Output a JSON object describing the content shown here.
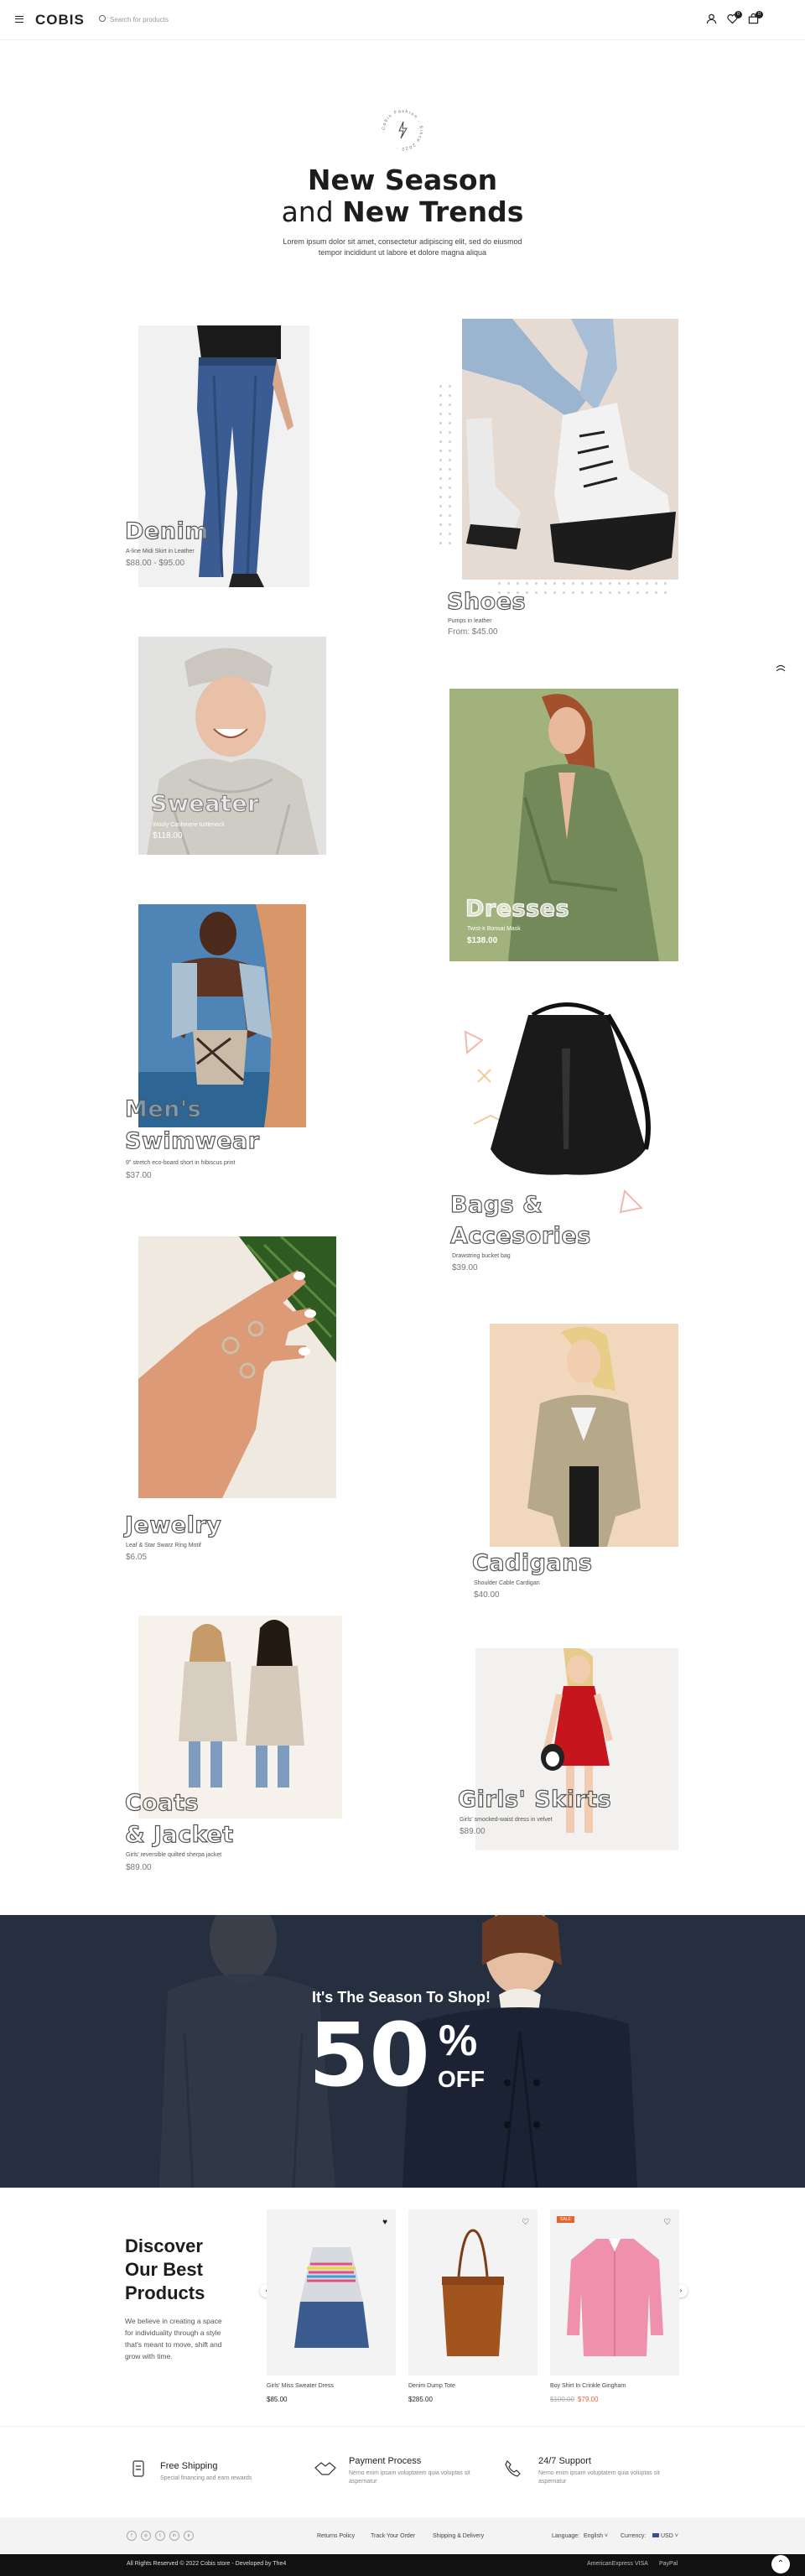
{
  "header": {
    "logo": "COBIS",
    "search_placeholder": "Search for products",
    "wishlist_count": "0",
    "cart_count": "0"
  },
  "hero": {
    "stamp_text": "Cobis Fashion · Since 2022 ·",
    "title_line1": "New Season",
    "title_line2_plain": "and ",
    "title_line2_bold": "New Trends",
    "subtitle": "Lorem ipsum dolor sit amet, consectetur adipiscing elit, sed do eiusmod tempor incididunt ut labore et dolore magna aliqua"
  },
  "categories": [
    {
      "name": "Denim",
      "desc": "A-line Midi Skirt in Leather",
      "price": "$88.00 - $95.00"
    },
    {
      "name": "Shoes",
      "desc": "Pumps in leather",
      "price": "From: $45.00"
    },
    {
      "name": "Sweater",
      "desc": "Wooly Cashmere turtleneck",
      "price": "$118.00"
    },
    {
      "name": "Dresses",
      "desc": "Twist-k Bonsai Mask",
      "price": "$138.00"
    },
    {
      "name_l1": "Men's",
      "name_l2": "Swimwear",
      "desc": "9\" stretch eco-board short in hibiscus print",
      "price": "$37.00"
    },
    {
      "name_l1": "Bags &",
      "name_l2": "Accesories",
      "desc": "Drawstring bucket bag",
      "price": "$39.00"
    },
    {
      "name": "Jewelry",
      "desc": "Leaf & Star Swarz Ring Motif",
      "price": "$6.05"
    },
    {
      "name": "Cadigans",
      "desc": "Shoulder Cable Cardigan",
      "price": "$40.00"
    },
    {
      "name_l1": "Coats",
      "name_l2": "& Jacket",
      "desc": "Girls' reversible quilted sherpa jacket",
      "price": "$89.00"
    },
    {
      "name": "Girls' Skirts",
      "desc": "Girls' smocked-waist dress in velvet",
      "price": "$89.00"
    }
  ],
  "banner": {
    "headline": "It's The Season To Shop!",
    "percent": "50",
    "percent_sign": "%",
    "off": "OFF"
  },
  "best": {
    "title_l1": "Discover",
    "title_l2": "Our Best",
    "title_l3": "Products",
    "text": "We believe in creating a space for individuality through a style that's meant to move, shift and grow with time.",
    "products": [
      {
        "name": "Girls' Miss Sweater Dress",
        "price": "$85.00"
      },
      {
        "name": "Denim Dump Tote",
        "price": "$285.00"
      },
      {
        "name": "Boy Shirt In Crinkle Gingham",
        "old_price": "$100.00",
        "price": "$79.00",
        "badge": "SALE"
      }
    ]
  },
  "services": [
    {
      "title": "Free Shipping",
      "sub": "Special financing and earn rewards"
    },
    {
      "title": "Payment Process",
      "sub": "Nemo enim ipsam voluptatem quia voluptas sit aspernatur"
    },
    {
      "title": "24/7 Support",
      "sub": "Nemo enim ipsam voluptatem quia voluptas sit aspernatur"
    }
  ],
  "footer": {
    "links": [
      "Returns Policy",
      "Track Your Order",
      "Shipping & Delivery"
    ],
    "language_label": "Language:",
    "language_value": "English",
    "currency_label": "Currency:",
    "currency_value": "USD",
    "copyright": "All Rights Reserved © 2022 Cobis store - Developed by The4",
    "payments": [
      "AmericanExpress",
      "VISA",
      "PayPal"
    ]
  },
  "colors": {
    "banner_bg": "#262f3f",
    "dresses_bg": "#a2b27c",
    "sale_badge": "#e8632b",
    "accent_price": "#e8632b"
  }
}
